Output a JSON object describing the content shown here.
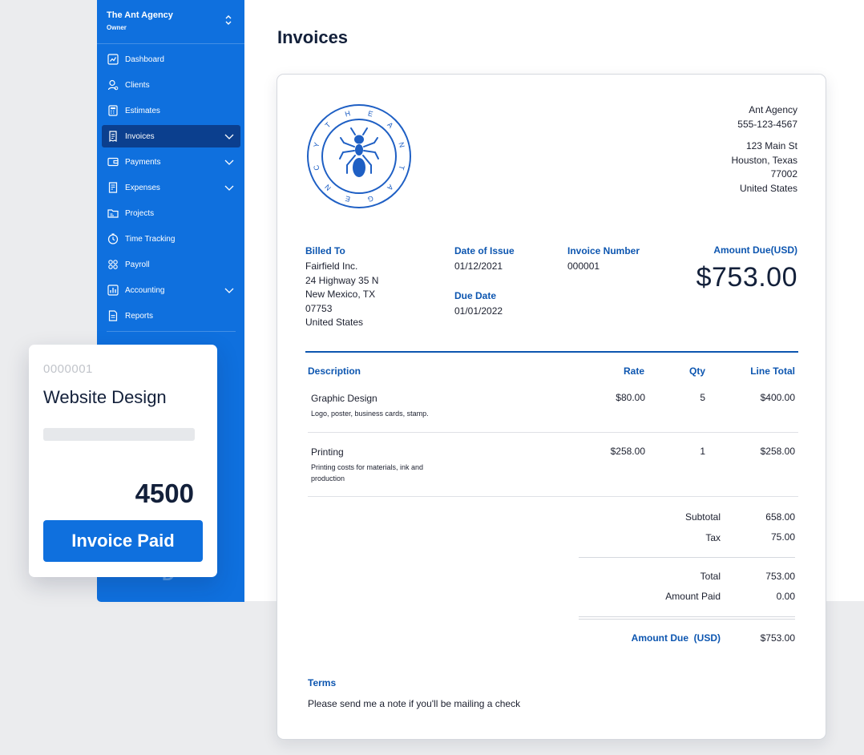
{
  "sidebar": {
    "workspace_name": "The Ant Agency",
    "workspace_role": "Owner",
    "items": [
      {
        "label": "Dashboard",
        "icon": "dashboard-icon"
      },
      {
        "label": "Clients",
        "icon": "clients-icon"
      },
      {
        "label": "Estimates",
        "icon": "estimates-icon"
      },
      {
        "label": "Invoices",
        "icon": "invoices-icon",
        "active": true,
        "expandable": true
      },
      {
        "label": "Payments",
        "icon": "payments-icon",
        "expandable": true
      },
      {
        "label": "Expenses",
        "icon": "expenses-icon",
        "expandable": true
      },
      {
        "label": "Projects",
        "icon": "projects-icon"
      },
      {
        "label": "Time Tracking",
        "icon": "time-tracking-icon"
      },
      {
        "label": "Payroll",
        "icon": "payroll-icon"
      },
      {
        "label": "Accounting",
        "icon": "accounting-icon",
        "expandable": true
      },
      {
        "label": "Reports",
        "icon": "reports-icon"
      }
    ]
  },
  "page": {
    "title": "Invoices"
  },
  "invoice": {
    "company": {
      "name": "Ant Agency",
      "phone": "555-123-4567",
      "street": "123 Main St",
      "city_state": "Houston, Texas",
      "zip": "77002",
      "country": "United States"
    },
    "logo": {
      "letters": [
        "T",
        "H",
        "E",
        "A",
        "N",
        "T",
        "A",
        "G",
        "E",
        "N",
        "C",
        "Y"
      ]
    },
    "billed_to": {
      "label": "Billed To",
      "name": "Fairfield Inc.",
      "address1": "24 Highway 35 N",
      "address2": "New Mexico, TX",
      "zip": "07753",
      "country": "United States"
    },
    "date_of_issue": {
      "label": "Date of Issue",
      "value": "01/12/2021"
    },
    "due_date": {
      "label": "Due Date",
      "value": "01/01/2022"
    },
    "invoice_number": {
      "label": "Invoice Number",
      "value": "000001"
    },
    "amount_due": {
      "label": "Amount Due(USD)",
      "value": "$753.00"
    },
    "columns": {
      "description": "Description",
      "rate": "Rate",
      "qty": "Qty",
      "line_total": "Line Total"
    },
    "line_items": [
      {
        "name": "Graphic Design",
        "note": "Logo, poster, business cards, stamp.",
        "note2": "",
        "rate": "$80.00",
        "qty": "5",
        "total": "$400.00"
      },
      {
        "name": "Printing",
        "note": "Printing costs for materials, ink and",
        "note2": "production",
        "rate": "$258.00",
        "qty": "1",
        "total": "$258.00"
      }
    ],
    "summary": {
      "subtotal_label": "Subtotal",
      "subtotal": "658.00",
      "tax_label": "Tax",
      "tax": "75.00",
      "total_label": "Total",
      "total": "753.00",
      "paid_label": "Amount Paid",
      "paid": "0.00",
      "due_label": "Amount Due  (USD)",
      "due": "$753.00"
    },
    "terms": {
      "label": "Terms",
      "text": "Please send me a note if you'll be mailing a check"
    }
  },
  "card": {
    "id": "0000001",
    "title": "Website Design",
    "amount": "4500",
    "button": "Invoice Paid"
  },
  "colors": {
    "brand": "#0f70de",
    "active_nav": "#0b3f8e",
    "label_blue": "#0d56b0",
    "logo_blue": "#1e5fc4"
  }
}
